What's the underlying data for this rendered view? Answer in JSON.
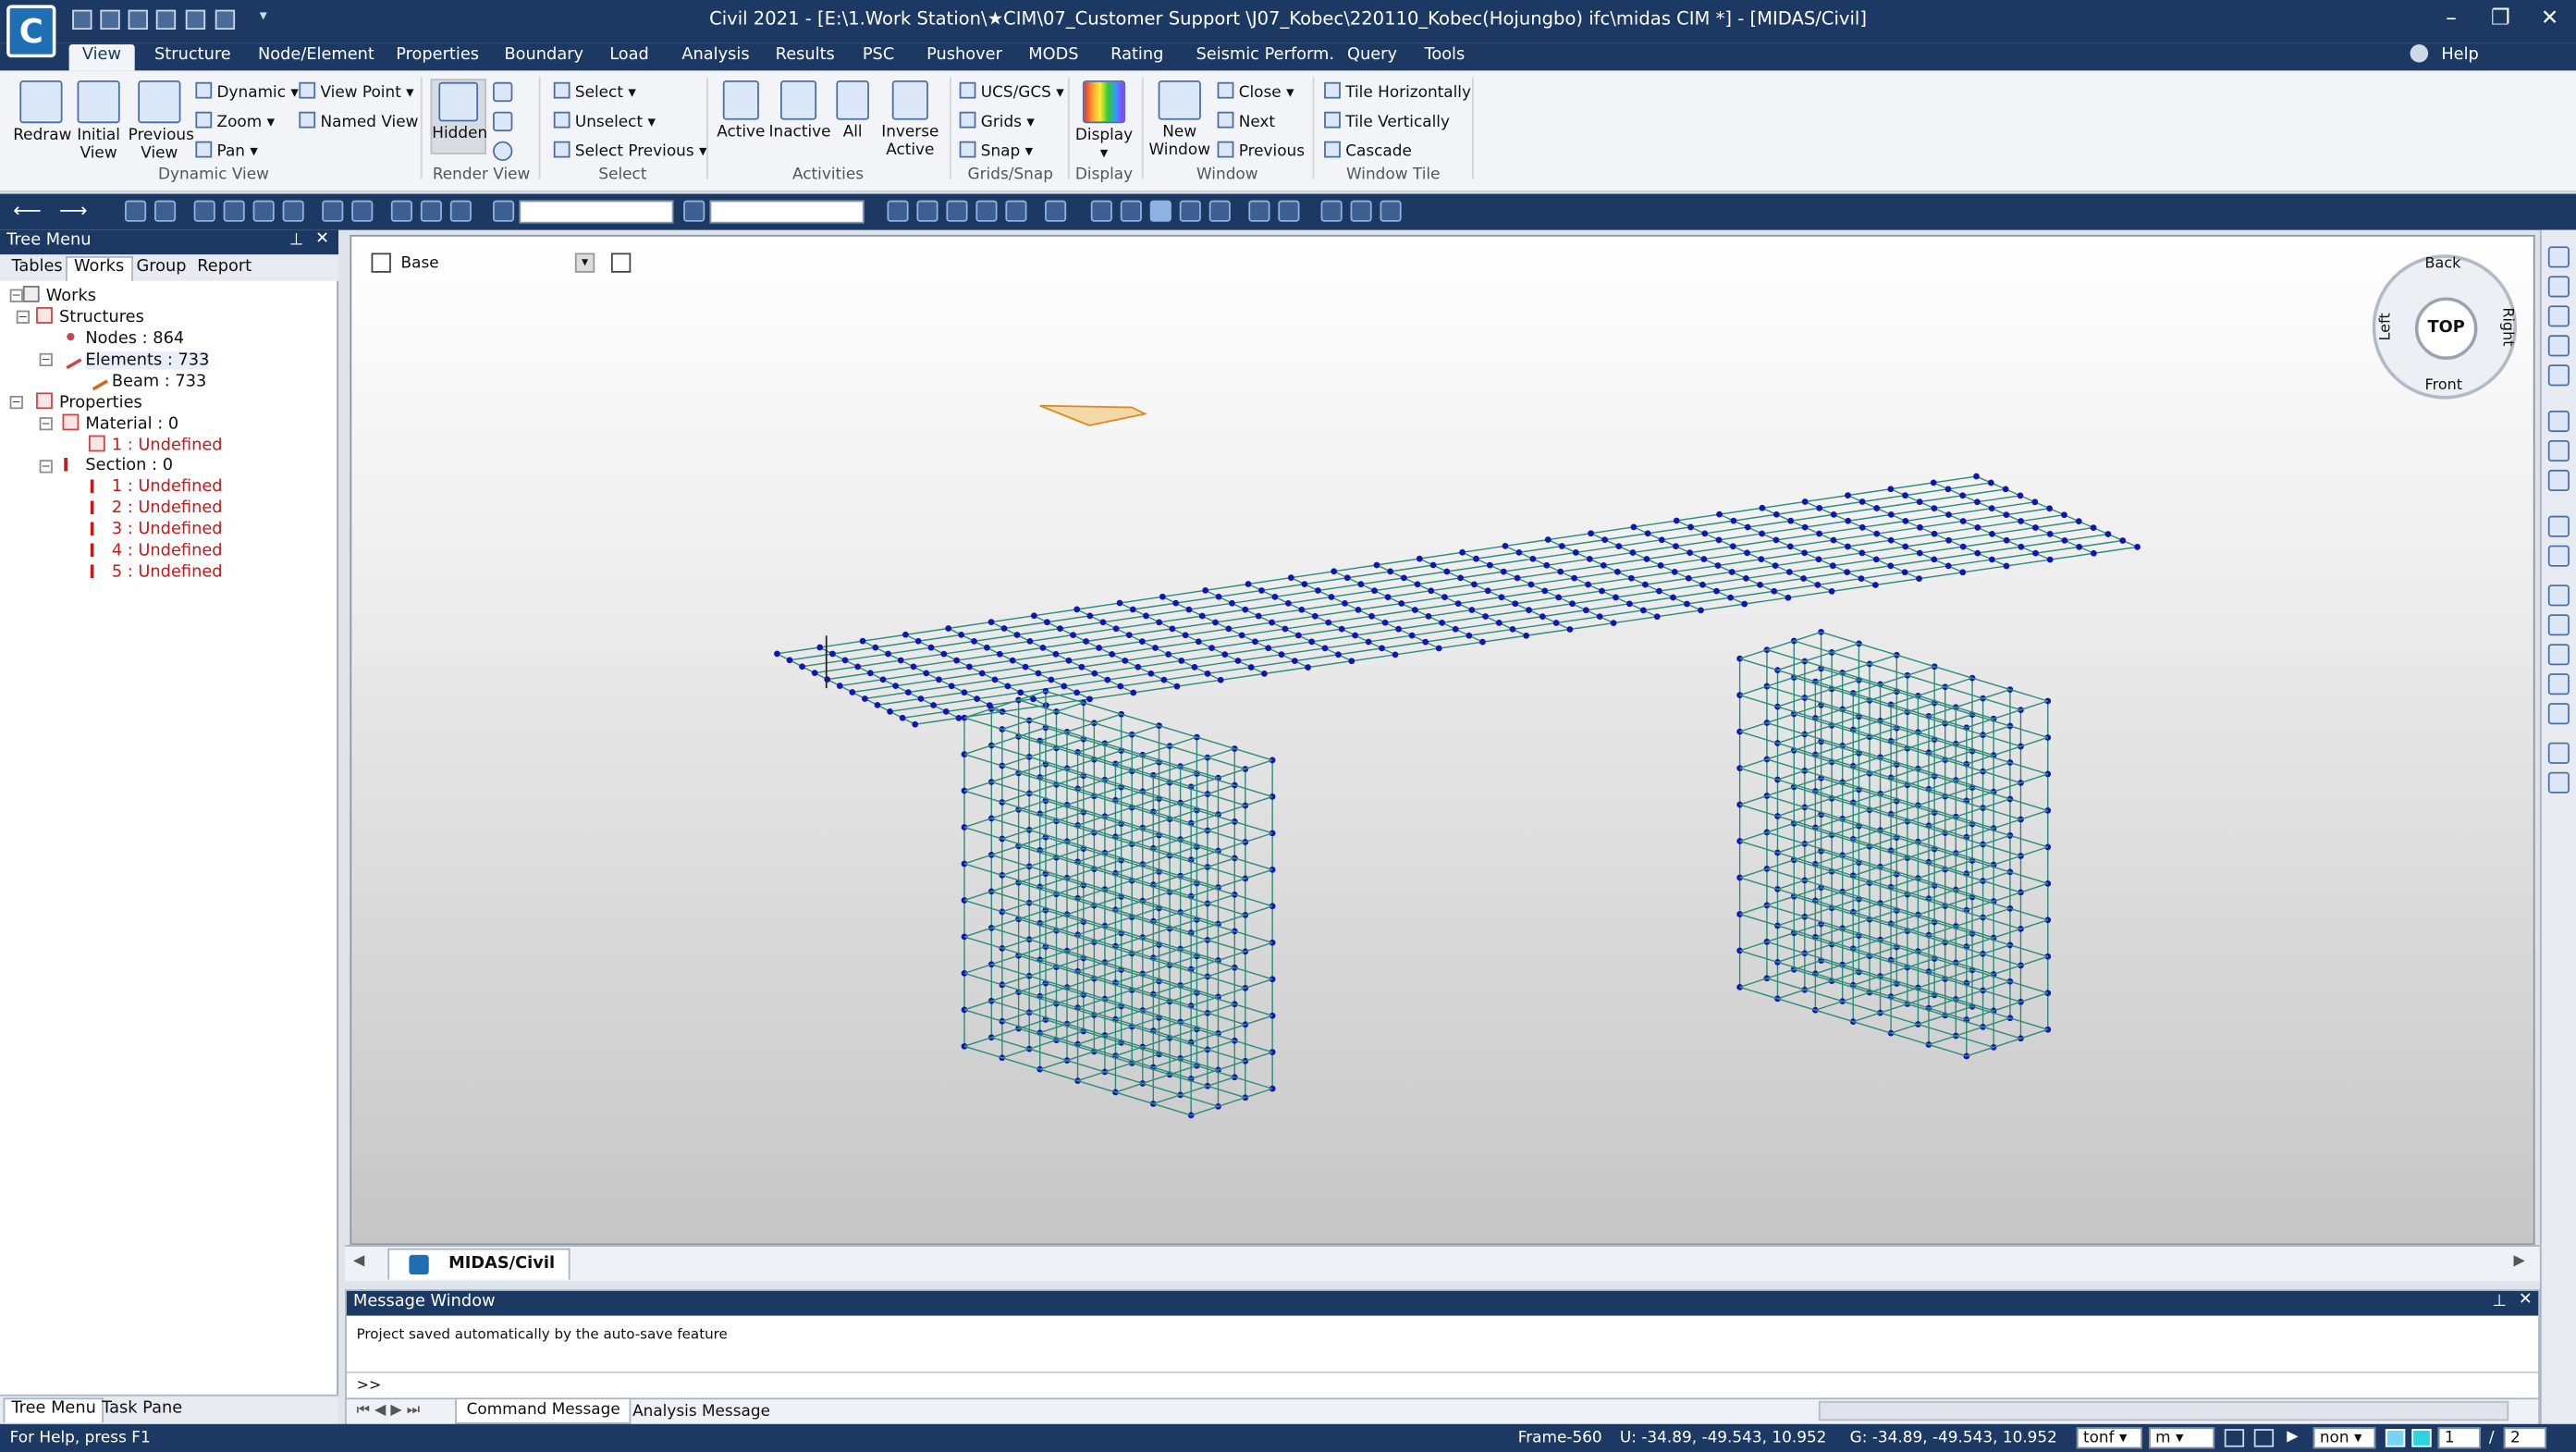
{
  "window": {
    "app_letter": "C",
    "title": "Civil 2021 - [E:\\1.Work Station\\★CIM\\07_Customer Support \\J07_Kobec\\220110_Kobec(Hojungbo) ifc\\midas CIM *] - [MIDAS/Civil]",
    "minimize": "–",
    "restore": "❐",
    "close": "✕"
  },
  "menu": {
    "tabs": [
      "View",
      "Structure",
      "Node/Element",
      "Properties",
      "Boundary",
      "Load",
      "Analysis",
      "Results",
      "PSC",
      "Pushover",
      "MODS",
      "Rating",
      "Seismic Perform.",
      "Query",
      "Tools"
    ],
    "active": "View",
    "help": "Help"
  },
  "ribbon": {
    "dynamic_view": {
      "redraw": "Redraw",
      "initial_view": [
        "Initial",
        "View"
      ],
      "previous_view": [
        "Previous",
        "View"
      ],
      "dynamic": "Dynamic",
      "zoom": "Zoom",
      "pan": "Pan",
      "view_point": "View Point",
      "named_view": "Named View",
      "group": "Dynamic View"
    },
    "render_view": {
      "hidden": "Hidden",
      "group": "Render View"
    },
    "select": {
      "select": "Select",
      "unselect": "Unselect",
      "select_previous": "Select Previous",
      "group": "Select"
    },
    "activities": {
      "active": "Active",
      "inactive": "Inactive",
      "all": "All",
      "inverse_active": [
        "Inverse",
        "Active"
      ],
      "group": "Activities"
    },
    "grids_snap": {
      "ucs_gcs": "UCS/GCS",
      "grids": "Grids",
      "snap": "Snap",
      "group": "Grids/Snap"
    },
    "display": {
      "display": "Display",
      "group": "Display"
    },
    "window": {
      "new_window": [
        "New",
        "Window"
      ],
      "close": "Close",
      "next": "Next",
      "previous": "Previous",
      "group": "Window"
    },
    "window_tile": {
      "tile_horizontally": "Tile Horizontally",
      "tile_vertically": "Tile Vertically",
      "cascade": "Cascade",
      "group": "Window Tile"
    }
  },
  "tree": {
    "title": "Tree Menu",
    "tabs": [
      "Tables",
      "Works",
      "Group",
      "Report"
    ],
    "active_tab": "Works",
    "items": {
      "works": "Works",
      "structures": "Structures",
      "nodes": "Nodes : 864",
      "elements": "Elements : 733",
      "beam": "Beam : 733",
      "properties": "Properties",
      "material": "Material : 0",
      "material_1": "1 : Undefined",
      "section": "Section : 0",
      "sections": [
        "1 : Undefined",
        "2 : Undefined",
        "3 : Undefined",
        "4 : Undefined",
        "5 : Undefined"
      ]
    },
    "bottom_tabs": [
      "Tree Menu",
      "Task Pane"
    ]
  },
  "viewport": {
    "layer": "Base",
    "viewcube": {
      "top": "TOP",
      "back": "Back",
      "front": "Front",
      "left": "Left",
      "right": "Right"
    }
  },
  "doc_tab": "MIDAS/Civil",
  "message_window": {
    "title": "Message Window",
    "message": "Project saved automatically by the auto-save feature",
    "prompt": ">>",
    "tabs": [
      "Command Message",
      "Analysis Message"
    ]
  },
  "status": {
    "help": "For Help, press F1",
    "frame": "Frame-560",
    "u_coords": "U: -34.89, -49.543, 10.952",
    "g_coords": "G: -34.89, -49.543, 10.952",
    "force_unit": "tonf",
    "length_unit": "m",
    "non": "non",
    "count1": "1",
    "count2": "2"
  },
  "colors": {
    "node": "#1414b4",
    "element": "#2f8c7c",
    "chrome": "#1c3964"
  }
}
